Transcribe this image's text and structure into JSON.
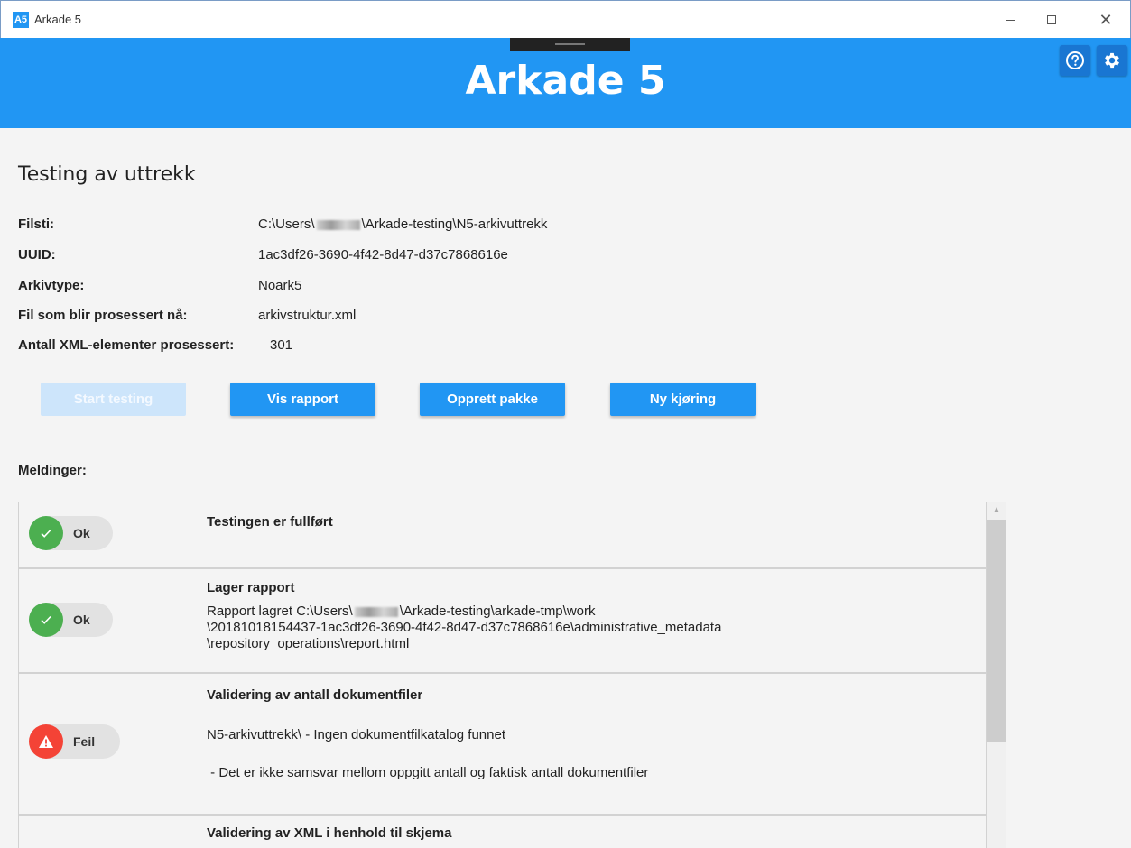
{
  "window": {
    "icon_label": "A5",
    "title": "Arkade 5",
    "controls": {
      "minimize": "minimize-icon",
      "maximize": "maximize-icon",
      "close": "close-icon",
      "close_glyph": "✕"
    }
  },
  "header": {
    "title": "Arkade 5",
    "background": "#2196f3",
    "buttons": [
      {
        "icon": "help-icon"
      },
      {
        "icon": "gear-icon"
      }
    ]
  },
  "page": {
    "title": "Testing av uttrekk",
    "info": [
      {
        "label": "Filsti:",
        "value_prefix": "C:\\Users\\",
        "value_suffix": "\\Arkade-testing\\N5-arkivuttrekk",
        "redacted": true
      },
      {
        "label": "UUID:",
        "value": "1ac3df26-3690-4f42-8d47-d37c7868616e"
      },
      {
        "label": "Arkivtype:",
        "value": "Noark5"
      },
      {
        "label": "Fil som blir prosessert nå:",
        "value": "arkivstruktur.xml"
      },
      {
        "label": "Antall XML-elementer prosessert:",
        "value": "301"
      }
    ],
    "buttons": [
      {
        "label": "Start testing",
        "enabled": false
      },
      {
        "label": "Vis rapport",
        "enabled": true
      },
      {
        "label": "Opprett pakke",
        "enabled": true
      },
      {
        "label": "Ny kjøring",
        "enabled": true
      }
    ],
    "messages_label": "Meldinger:"
  },
  "messages": [
    {
      "status": "Ok",
      "status_color": "#4caf50",
      "icon": "check-icon",
      "title": "Testingen er fullført",
      "lines": []
    },
    {
      "status": "Ok",
      "status_color": "#4caf50",
      "icon": "check-icon",
      "title": "Lager rapport",
      "line1_prefix": "Rapport lagret C:\\Users\\",
      "line1_suffix": "\\Arkade-testing\\arkade-tmp\\work",
      "lines": [
        "\\20181018154437-1ac3df26-3690-4f42-8d47-d37c7868616e\\administrative_metadata",
        "\\repository_operations\\report.html"
      ]
    },
    {
      "status": "Feil",
      "status_color": "#f44336",
      "icon": "warning-icon",
      "title": "Validering av antall dokumentfiler",
      "lines": [
        "N5-arkivuttrekk\\ - Ingen dokumentfilkatalog funnet",
        " - Det er ikke samsvar mellom oppgitt antall og faktisk antall dokumentfiler"
      ]
    },
    {
      "status": "",
      "title": "Validering av XML i henhold til skjema",
      "lines": []
    }
  ],
  "scrollbar": {
    "up_glyph": "▲"
  }
}
